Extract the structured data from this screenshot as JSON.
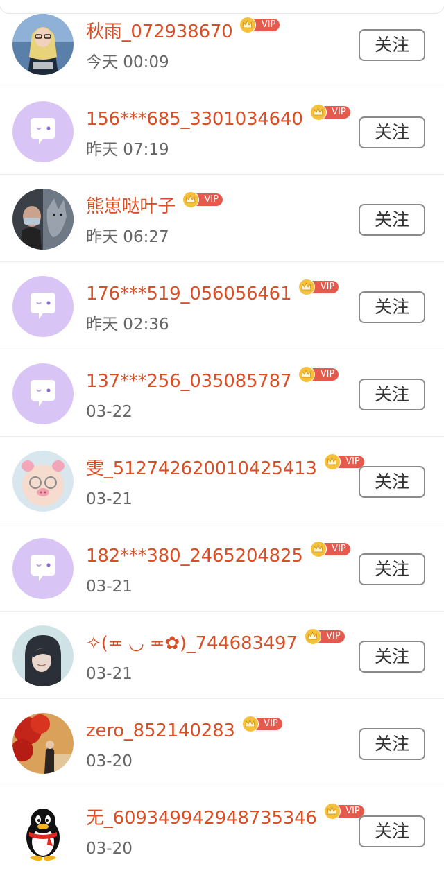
{
  "follow_label": "关注",
  "vip_label": "VIP",
  "colors": {
    "name": "#d84f26",
    "vip_badge": "#e65a4e",
    "crown": "#f6c13a",
    "default_avatar": "#d9c4f6",
    "time": "#666666"
  },
  "users": [
    {
      "name": "秋雨_072938670",
      "time": "今天 00:09",
      "avatar": "photo-blonde-woman"
    },
    {
      "name": "156***685_3301034640",
      "time": "昨天 07:19",
      "avatar": "default-chat-bubble"
    },
    {
      "name": "熊崽哒叶子",
      "time": "昨天 06:27",
      "avatar": "photo-man-wolf"
    },
    {
      "name": "176***519_056056461",
      "time": "昨天 02:36",
      "avatar": "default-chat-bubble"
    },
    {
      "name": "137***256_035085787",
      "time": "03-22",
      "avatar": "default-chat-bubble"
    },
    {
      "name": "雯_512742620010425413",
      "time": "03-21",
      "avatar": "photo-baby-pig-filter"
    },
    {
      "name": "182***380_2465204825",
      "time": "03-21",
      "avatar": "default-chat-bubble"
    },
    {
      "name": "✧(≖ ◡ ≖✿)_744683497",
      "time": "03-21",
      "avatar": "illustration-hooded-girl"
    },
    {
      "name": "zero_852140283",
      "time": "03-20",
      "avatar": "photo-red-leaves"
    },
    {
      "name": "无_609349942948735346",
      "time": "03-20",
      "avatar": "qq-penguin"
    }
  ]
}
